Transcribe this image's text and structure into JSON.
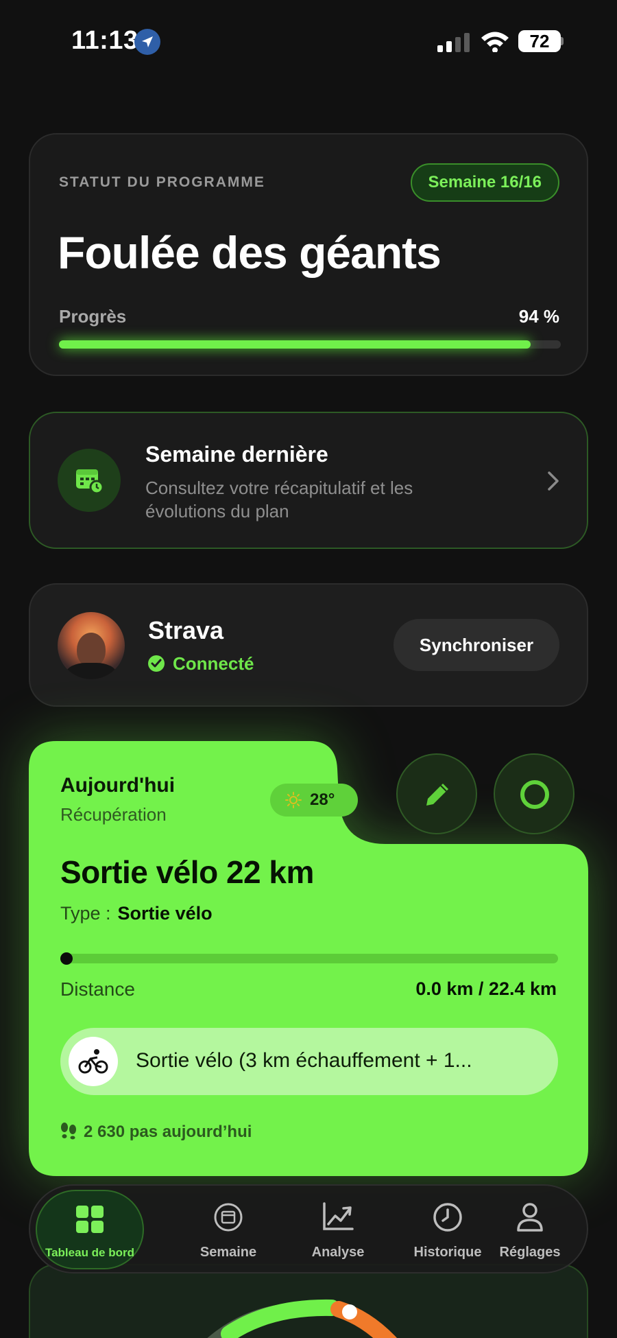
{
  "status_bar": {
    "time": "11:13",
    "battery": "72"
  },
  "program": {
    "status_label": "STATUT DU PROGRAMME",
    "week_badge": "Semaine 16/16",
    "title": "Foulée des géants",
    "progress_label": "Progrès",
    "progress_text": "94 %",
    "progress_value": 0.94
  },
  "recap": {
    "title": "Semaine dernière",
    "subtitle": "Consultez votre récapitulatif et les évolutions du plan"
  },
  "strava": {
    "name": "Strava",
    "status": "Connecté",
    "sync_label": "Synchroniser"
  },
  "today": {
    "label": "Aujourd'hui",
    "sublabel": "Récupération",
    "weather": "28°",
    "workout_title": "Sortie vélo 22 km",
    "type_label": "Type :",
    "type_value": "Sortie vélo",
    "distance_label": "Distance",
    "distance_value": "0.0 km / 22.4 km",
    "distance_progress": 0,
    "description": "Sortie vélo (3 km échauffement + 1...",
    "steps": "2 630 pas aujourd’hui"
  },
  "tabbar": {
    "tabs": [
      {
        "label": "Tableau de bord",
        "icon": "grid-icon",
        "active": true
      },
      {
        "label": "Semaine",
        "icon": "calendar-icon",
        "active": false
      },
      {
        "label": "Analyse",
        "icon": "chart-trend-icon",
        "active": false
      },
      {
        "label": "Historique",
        "icon": "clock-icon",
        "active": false
      },
      {
        "label": "Réglages",
        "icon": "person-icon",
        "active": false
      }
    ]
  },
  "colors": {
    "accent": "#70f04a",
    "background": "#111111",
    "today_card": "#73f24b"
  }
}
